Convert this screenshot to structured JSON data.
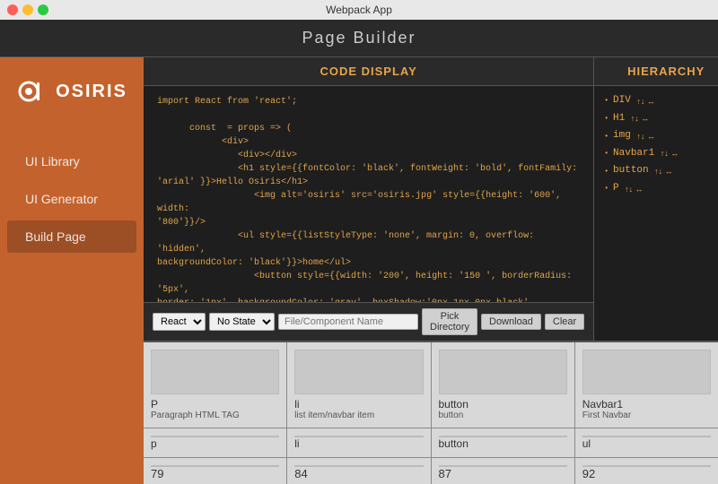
{
  "titleBar": {
    "title": "Webpack App"
  },
  "appHeader": {
    "title": "Page Builder"
  },
  "sidebar": {
    "logoText": "OSIRIS",
    "items": [
      {
        "id": "ui-library",
        "label": "UI Library",
        "active": false
      },
      {
        "id": "ui-generator",
        "label": "UI Generator",
        "active": false
      },
      {
        "id": "build-page",
        "label": "Build Page",
        "active": true
      }
    ]
  },
  "codeDisplay": {
    "header": "CODE DISPLAY",
    "code": "import React from 'react';\n\n      const  = props => (\n            <div>\n               <div></div>\n               <h1 style={{fontColor: 'black', fontWeight: 'bold', fontFamily:\n'arial' }}>Hello Osiris</h1>\n                  <img alt='osiris' src='osiris.jpg' style={{height: '600', width:\n'800'}}/>\n               <ul style={{listStyleType: 'none', margin: 0, overflow: 'hidden',\nbackgroundColor: 'black'}}>home</ul>\n                  <button style={{width: '200', height: '150 ', borderRadius: '5px',\nborder: '1px', backgroundColor: 'gray', boxShadow:'0px 1px 0px black', fontWeight:\n'normal', fontFamily: 'arial', fontStyle: 'normal'}}>Submit\nOsiris</button>\n                  <p style={{fontColor: 'black', fontWeight: 'normal', fontFamily:\n'arial' }}>Hello Osiris</p>\n               </div>\n         );\n\n      export default ;",
    "toolbar": {
      "reactLabel": "React",
      "stateLabel": "No State",
      "inputPlaceholder": "File/Component Name",
      "pickDirLabel": "Pick Directory",
      "downloadLabel": "Download",
      "clearLabel": "Clear"
    }
  },
  "hierarchy": {
    "header": "HIERARCHY",
    "items": [
      {
        "label": "DIV",
        "arrows": "↑↓ ↔"
      },
      {
        "label": "H1",
        "arrows": "↑↓ ↔"
      },
      {
        "label": "img",
        "arrows": "↑↓ ↔"
      },
      {
        "label": "Navbar1",
        "arrows": "↑↓ ↔"
      },
      {
        "label": "button",
        "arrows": "↑↓ ↔"
      },
      {
        "label": "P",
        "arrows": "↑↓ ↔"
      }
    ]
  },
  "componentGrid": {
    "cards": [
      {
        "tag": "P",
        "subTag": "",
        "number": "",
        "desc": "Paragraph HTML TAG"
      },
      {
        "tag": "li",
        "subTag": "",
        "number": "",
        "desc": "list item/navbar item"
      },
      {
        "tag": "button",
        "subTag": "",
        "number": "",
        "desc": "button"
      },
      {
        "tag": "Navbar1",
        "subTag": "",
        "number": "",
        "desc": "First Navbar"
      },
      {
        "tag": "p",
        "subTag": "",
        "number": "",
        "desc": ""
      },
      {
        "tag": "li",
        "subTag": "",
        "number": "",
        "desc": ""
      },
      {
        "tag": "button",
        "subTag": "",
        "number": "",
        "desc": ""
      },
      {
        "tag": "ul",
        "subTag": "",
        "number": "",
        "desc": ""
      },
      {
        "tag": "79",
        "subTag": "",
        "number": "",
        "desc": ""
      },
      {
        "tag": "84",
        "subTag": "",
        "number": "",
        "desc": ""
      },
      {
        "tag": "87",
        "subTag": "",
        "number": "",
        "desc": ""
      },
      {
        "tag": "92",
        "subTag": "",
        "number": "",
        "desc": ""
      }
    ]
  }
}
